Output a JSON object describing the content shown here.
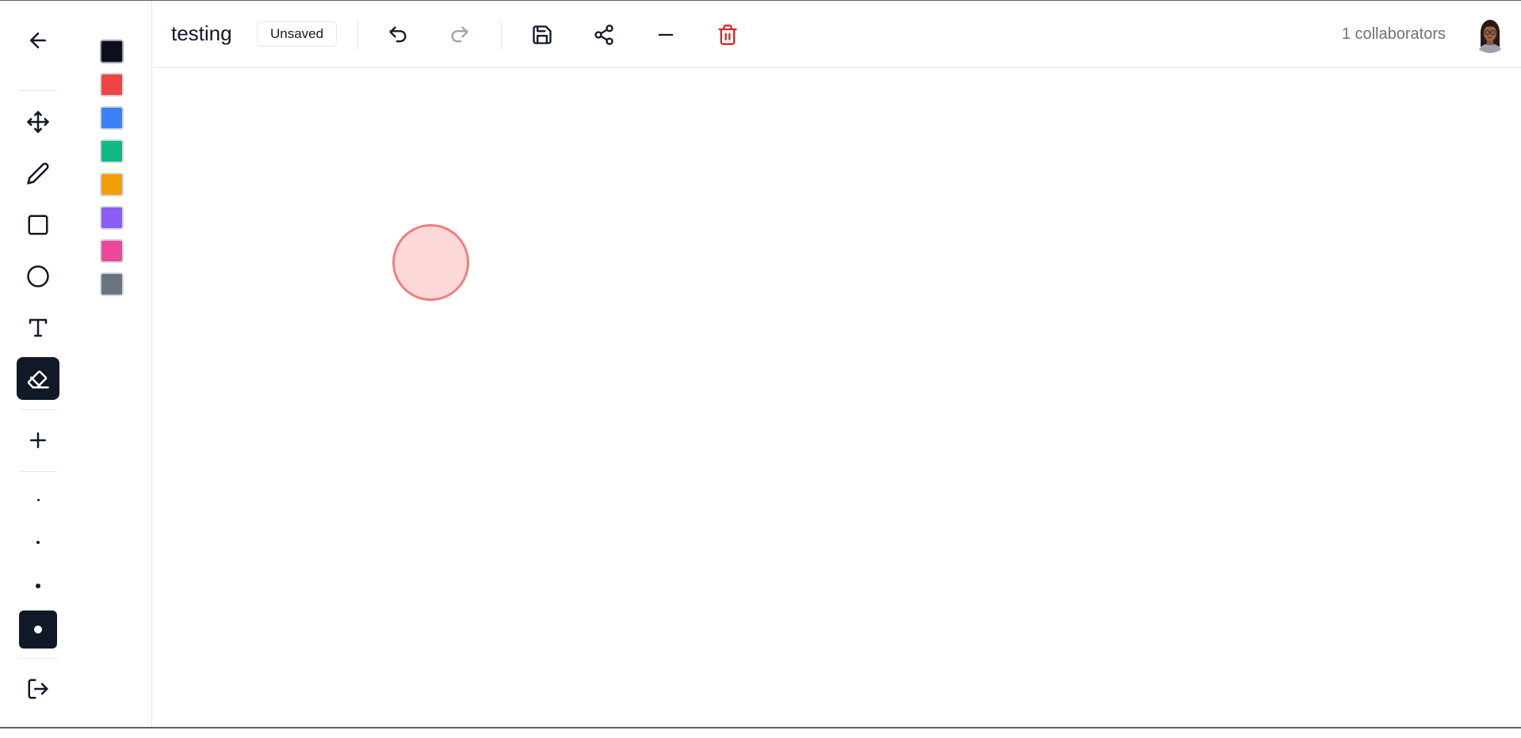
{
  "header": {
    "title": "testing",
    "status": "Unsaved",
    "collaborators": "1 collaborators"
  },
  "toolbar": {
    "icons": [
      "back-arrow-icon",
      "move-icon",
      "pencil-icon",
      "rectangle-icon",
      "circle-icon",
      "text-icon",
      "eraser-icon",
      "plus-icon",
      "logout-icon"
    ],
    "active_tool": "eraser",
    "stroke_sizes": [
      "xs",
      "sm",
      "md",
      "lg"
    ],
    "active_stroke_size": "lg"
  },
  "palette": {
    "colors": [
      "#0b0f1a",
      "#ef4444",
      "#3b82f6",
      "#10b981",
      "#f59e0b",
      "#8b5cf6",
      "#ec4899",
      "#6b7280"
    ],
    "selected": "#0b0f1a"
  },
  "canvas": {
    "shapes": [
      {
        "type": "circle",
        "fill": "#fdd8d8",
        "stroke": "#f08080"
      }
    ]
  }
}
